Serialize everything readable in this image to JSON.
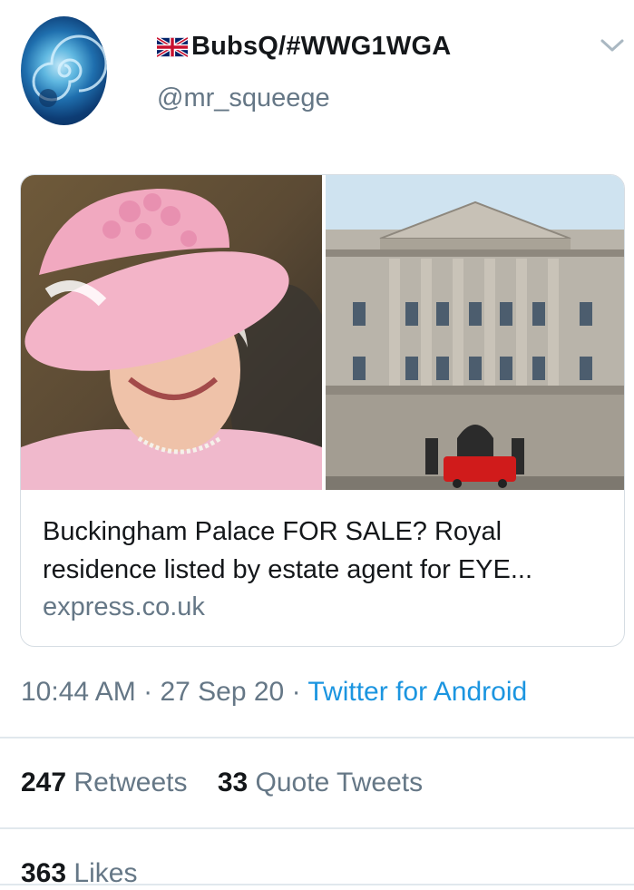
{
  "tweet": {
    "display_name": "BubsQ/#WWG1WGA",
    "flag_icon": "uk-flag-icon",
    "handle": "@mr_squeege",
    "card": {
      "title": "Buckingham Palace FOR SALE? Royal residence listed by estate agent for EYE...",
      "domain": "express.co.uk"
    },
    "meta": {
      "time": "10:44 AM",
      "separator": "·",
      "date": "27 Sep 20",
      "source": "Twitter for Android"
    },
    "stats": {
      "retweets_count": "247",
      "retweets_label": "Retweets",
      "quotes_count": "33",
      "quotes_label": "Quote Tweets",
      "likes_count": "363",
      "likes_label": "Likes"
    }
  },
  "colors": {
    "text_primary": "#14171a",
    "text_secondary": "#657786",
    "link": "#1b95e0",
    "divider": "#e1e8ed"
  }
}
